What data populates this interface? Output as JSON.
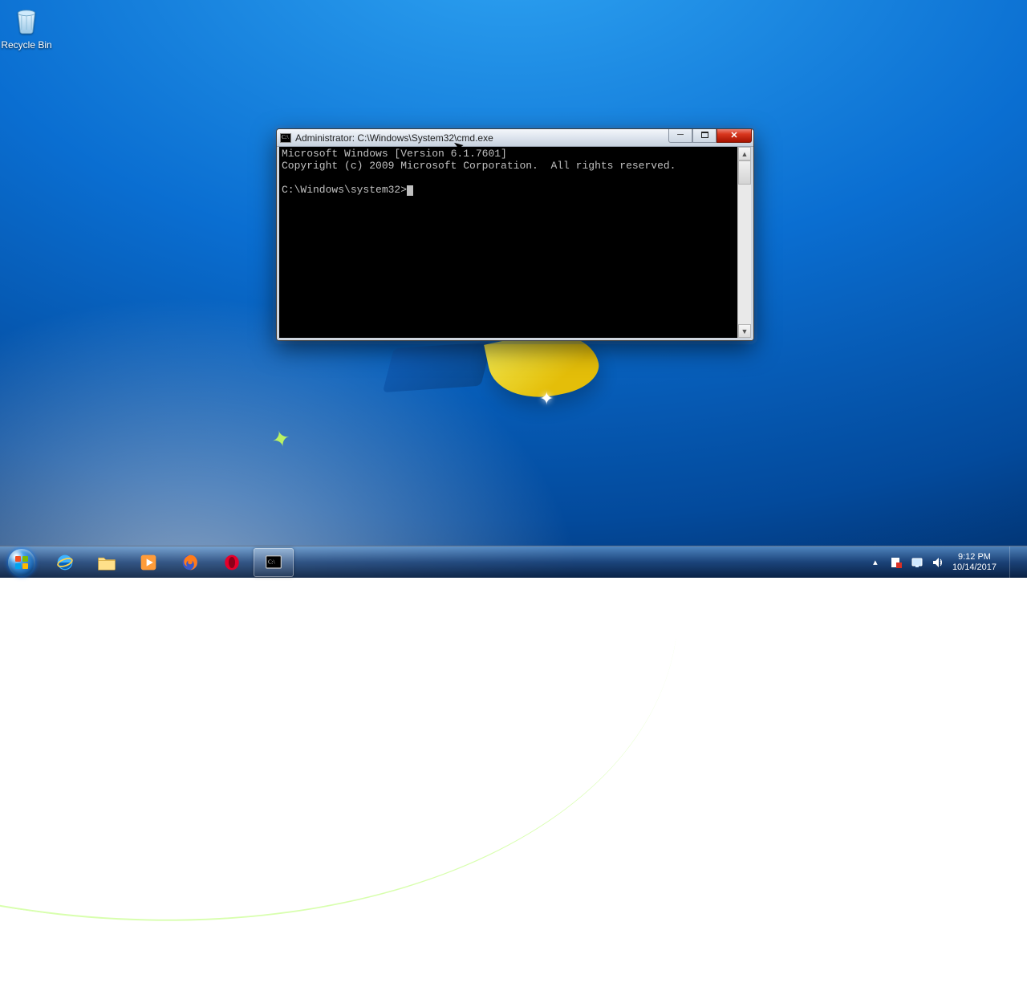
{
  "desktop": {
    "icons": {
      "recycle_bin_label": "Recycle Bin"
    }
  },
  "cmd": {
    "title": "Administrator: C:\\Windows\\System32\\cmd.exe",
    "line1": "Microsoft Windows [Version 6.1.7601]",
    "line2": "Copyright (c) 2009 Microsoft Corporation.  All rights reserved.",
    "prompt": "C:\\Windows\\system32>"
  },
  "taskbar": {
    "items": [
      "internet-explorer",
      "file-explorer",
      "media-player",
      "firefox",
      "opera",
      "cmd"
    ]
  },
  "tray": {
    "time": "9:12 PM",
    "date": "10/14/2017"
  }
}
